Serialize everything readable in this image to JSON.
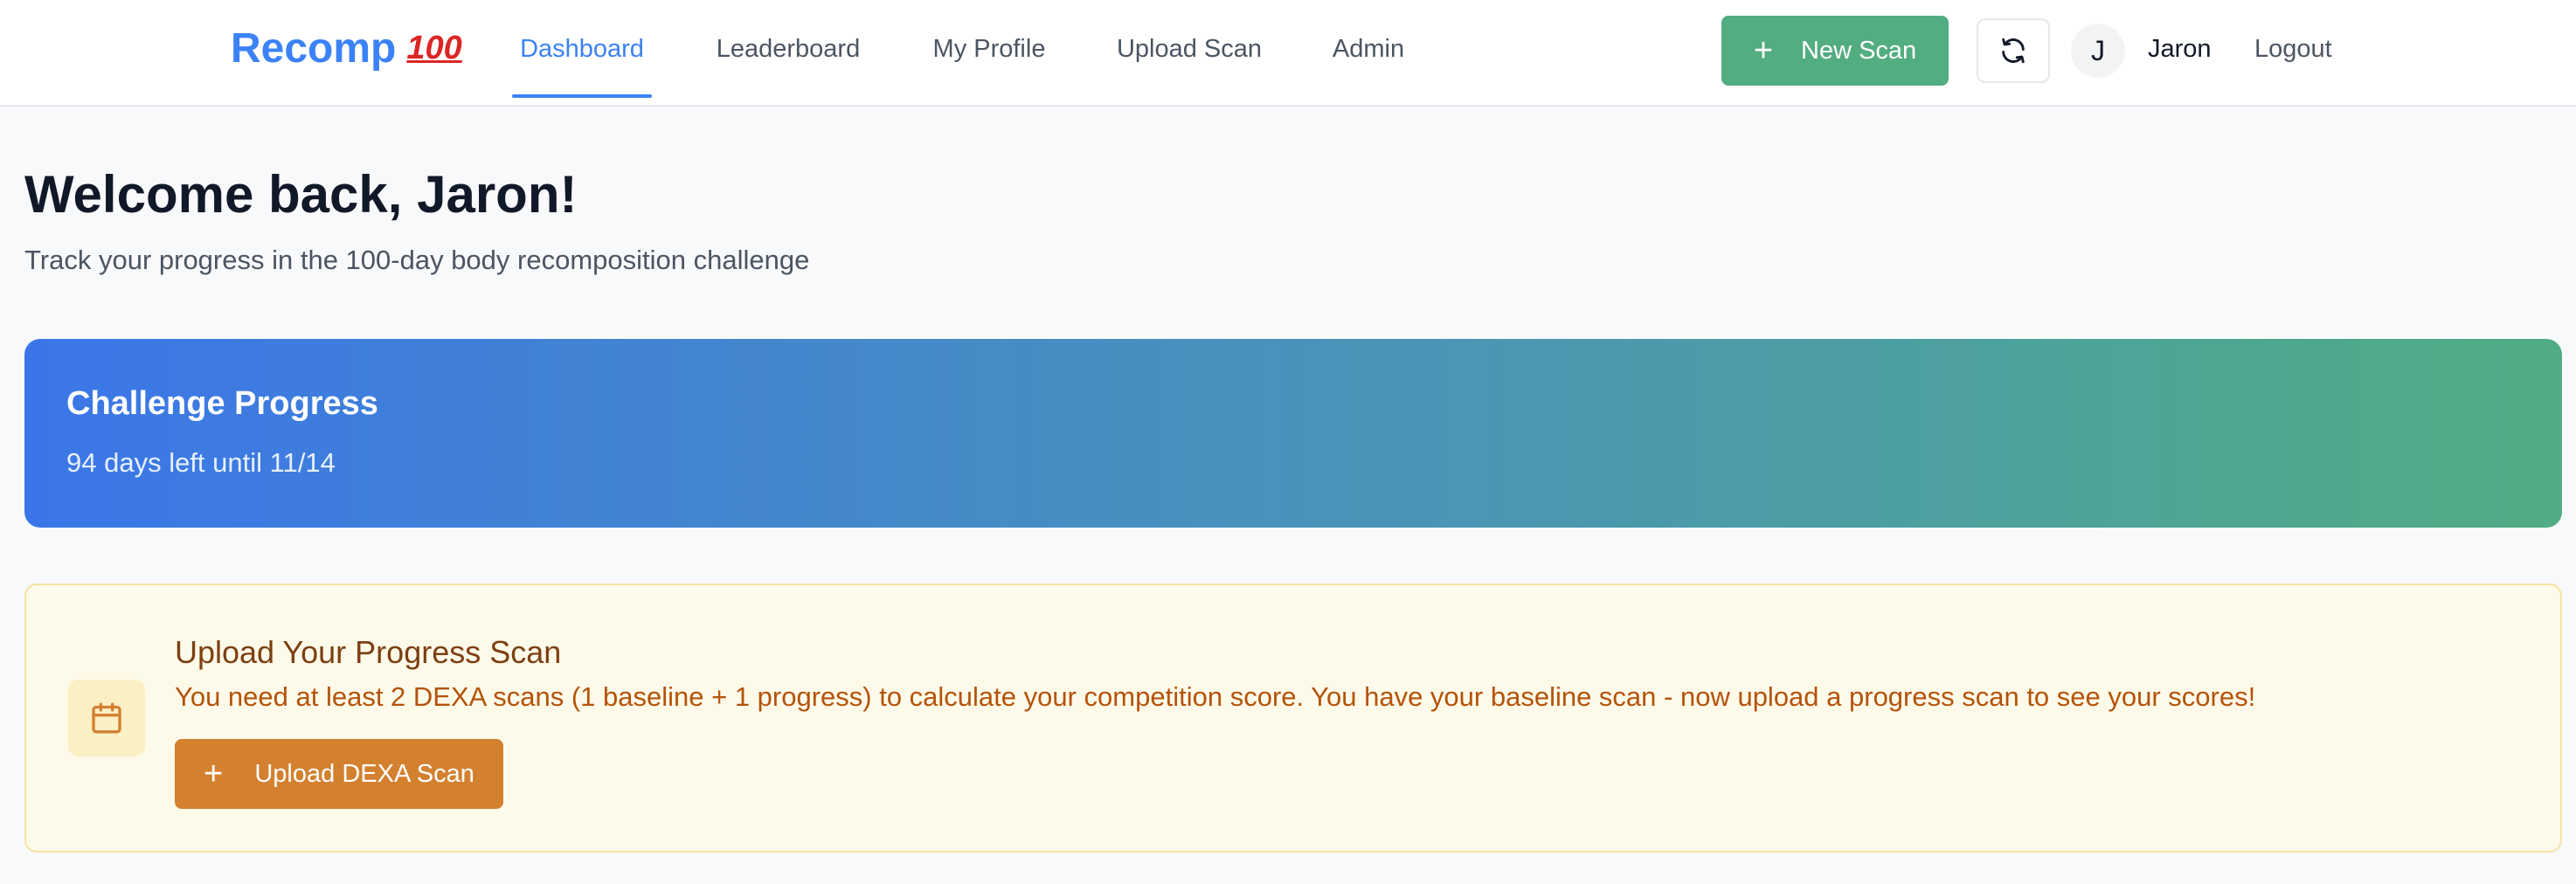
{
  "app": {
    "brand_name": "Recomp",
    "brand_mark": "100",
    "brand_color": "#3b82f6"
  },
  "nav": {
    "tabs": [
      {
        "label": "Dashboard",
        "active": true
      },
      {
        "label": "Leaderboard",
        "active": false
      },
      {
        "label": "My Profile",
        "active": false
      },
      {
        "label": "Upload Scan",
        "active": false
      },
      {
        "label": "Admin",
        "active": false
      }
    ],
    "new_scan_label": "New Scan",
    "new_scan_icon": "plus-icon",
    "refresh_icon": "refresh-icon",
    "user": {
      "initial": "J",
      "name": "Jaron"
    },
    "logout_label": "Logout"
  },
  "header": {
    "title": "Welcome back, Jaron!",
    "subtitle": "Track your progress in the 100-day body recomposition challenge"
  },
  "challenge": {
    "title": "Challenge Progress",
    "status": "94 days left until 11/14",
    "gradient_start": "#3b76e8",
    "gradient_end": "#50ad83"
  },
  "upload_card": {
    "icon": "calendar-icon",
    "title": "Upload Your Progress Scan",
    "message": "You need at least 2 DEXA scans (1 baseline + 1 progress) to calculate your competition score. You have your baseline scan - now upload a progress scan to see your scores!",
    "button_label": "Upload DEXA Scan",
    "button_icon": "plus-icon",
    "accent_color": "#d3802f"
  }
}
